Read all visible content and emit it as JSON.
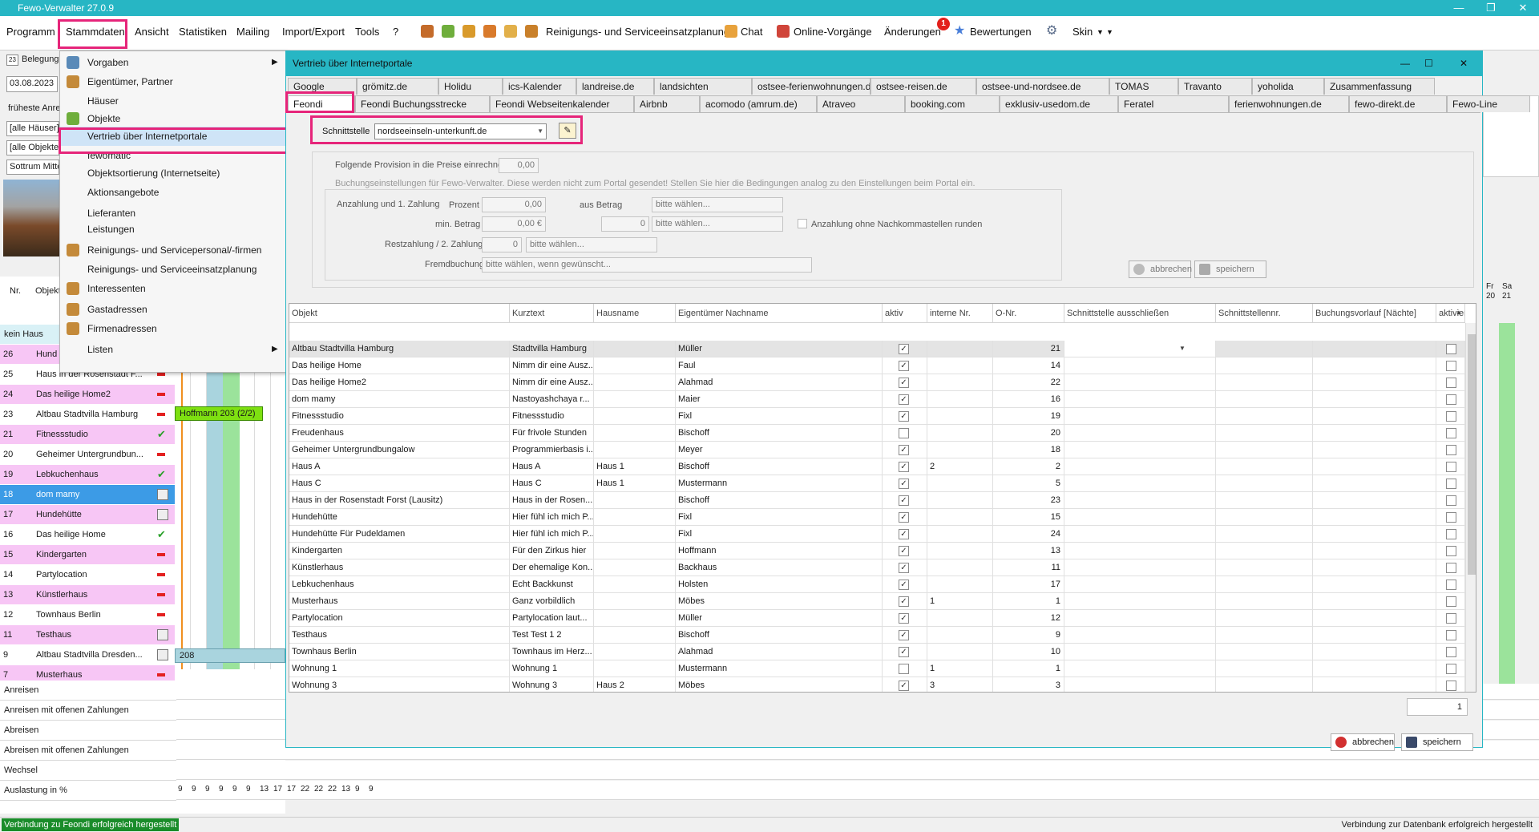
{
  "app": {
    "title": "Fewo-Verwalter 27.0.9"
  },
  "menu": {
    "items": [
      "Programm",
      "Stammdaten",
      "Ansicht",
      "Statistiken",
      "Mailing",
      "Import/Export",
      "Tools",
      "?"
    ],
    "tool_labels": [
      "Reinigungs- und Serviceeinsatzplanung",
      "Chat",
      "Online-Vorgänge",
      "Änderungen",
      "Bewertungen",
      "Skin"
    ],
    "badge": "1"
  },
  "dropdown": {
    "items": [
      {
        "label": "Vorgaben",
        "icon": "settings-icon",
        "submenu": true
      },
      {
        "label": "Eigentümer, Partner",
        "icon": "owner-icon"
      },
      {
        "label": "Häuser",
        "icon": ""
      },
      {
        "label": "Objekte",
        "icon": "house-icon"
      },
      {
        "label": "Vertrieb über Internetportale",
        "icon": "",
        "highlight": true
      },
      {
        "label": "fewomatic",
        "icon": ""
      },
      {
        "label": "Objektsortierung (Internetseite)",
        "icon": ""
      },
      {
        "label": "Aktionsangebote",
        "icon": ""
      },
      {
        "label": "Lieferanten",
        "icon": ""
      },
      {
        "label": "Leistungen",
        "icon": ""
      },
      {
        "label": "Reinigungs- und Servicepersonal/-firmen",
        "icon": "person-icon"
      },
      {
        "label": "Reinigungs- und Serviceeinsatzplanung",
        "icon": ""
      },
      {
        "label": "Interessenten",
        "icon": "person-icon"
      },
      {
        "label": "Gastadressen",
        "icon": "person-icon"
      },
      {
        "label": "Firmenadressen",
        "icon": "person-icon"
      },
      {
        "label": "Listen",
        "icon": "",
        "submenu": true
      }
    ]
  },
  "left": {
    "belegung": "Belegung",
    "date": "03.08.2023",
    "frueheste": "früheste Anre",
    "filter1": "[alle Häuser]",
    "filter2": "[alle Objekte",
    "filter3": "Sottrum Mitte",
    "col_nr": "Nr.",
    "col_obj": "Objekt",
    "kein_haus": "kein Haus",
    "rows": [
      {
        "nr": "26",
        "name": "Hund",
        "status": "red",
        "bg": "#f7c6f5"
      },
      {
        "nr": "25",
        "name": "Haus in der Rosenstadt F...",
        "status": "red",
        "bg": "#ffffff"
      },
      {
        "nr": "24",
        "name": "Das heilige Home2",
        "status": "red",
        "bg": "#f7c6f5"
      },
      {
        "nr": "23",
        "name": "Altbau Stadtvilla Hamburg",
        "status": "red",
        "bg": "#ffffff"
      },
      {
        "nr": "21",
        "name": "Fitnessstudio",
        "status": "green",
        "bg": "#f7c6f5"
      },
      {
        "nr": "20",
        "name": "Geheimer Untergrundbun...",
        "status": "red",
        "bg": "#ffffff"
      },
      {
        "nr": "19",
        "name": "Lebkuchenhaus",
        "status": "green",
        "bg": "#f7c6f5"
      },
      {
        "nr": "18",
        "name": "dom mamy",
        "status": "cal",
        "bg": "#3c9be6"
      },
      {
        "nr": "17",
        "name": "Hundehütte",
        "status": "cal",
        "bg": "#f7c6f5"
      },
      {
        "nr": "16",
        "name": "Das heilige Home",
        "status": "green",
        "bg": "#ffffff"
      },
      {
        "nr": "15",
        "name": "Kindergarten",
        "status": "red",
        "bg": "#f7c6f5"
      },
      {
        "nr": "14",
        "name": "Partylocation",
        "status": "red",
        "bg": "#ffffff"
      },
      {
        "nr": "13",
        "name": "Künstlerhaus",
        "status": "red",
        "bg": "#f7c6f5"
      },
      {
        "nr": "12",
        "name": "Townhaus Berlin",
        "status": "red",
        "bg": "#ffffff"
      },
      {
        "nr": "11",
        "name": "Testhaus",
        "status": "cal",
        "bg": "#f7c6f5"
      },
      {
        "nr": "9",
        "name": "Altbau Stadtvilla Dresden...",
        "status": "cal",
        "bg": "#ffffff"
      },
      {
        "nr": "7",
        "name": "Musterhaus",
        "status": "red",
        "bg": "#f7c6f5"
      }
    ],
    "booking1": "Hoffmann 203 (2/2)",
    "booking2": "208",
    "summary": [
      "Anreisen",
      "Anreisen mit offenen Zahlungen",
      "Abreisen",
      "Abreisen mit offenen Zahlungen",
      "Wechsel",
      "Auslastung in %"
    ],
    "auslastung": [
      "9",
      "9",
      "9",
      "9",
      "9",
      "9",
      "13",
      "17",
      "17",
      "22",
      "22",
      "22",
      "13",
      "9",
      "9"
    ],
    "cal_days": [
      "Fr",
      "Sa"
    ],
    "cal_nums": [
      "20",
      "21"
    ]
  },
  "dialog": {
    "title": "Vertrieb über Internetportale",
    "tabs_row1": [
      "Google",
      "grömitz.de",
      "Holidu",
      "ics-Kalender",
      "landreise.de",
      "landsichten",
      "ostsee-ferienwohnungen.de",
      "ostsee-reisen.de",
      "ostsee-und-nordsee.de",
      "TOMAS",
      "Travanto",
      "yoholida",
      "Zusammenfassung"
    ],
    "tabs_row2": [
      "Feondi",
      "Feondi Buchungsstrecke",
      "Feondi Webseitenkalender",
      "Airbnb",
      "acomodo (amrum.de)",
      "Atraveo",
      "booking.com",
      "exklusiv-usedom.de",
      "Feratel",
      "ferienwohnungen.de",
      "fewo-direkt.de",
      "Fewo-Line"
    ],
    "schnittstelle_label": "Schnittstelle",
    "schnittstelle_value": "nordseeinseln-unterkunft.de",
    "provision_label": "Folgende Provision in die Preise einrechnen",
    "provision_value": "0,00",
    "buchung_note": "Buchungseinstellungen für Fewo-Verwalter. Diese werden nicht zum Portal gesendet! Stellen Sie hier die Bedingungen analog zu den Einstellungen beim Portal ein.",
    "anzahlung_label": "Anzahlung und 1. Zahlung",
    "prozent_label": "Prozent",
    "prozent_value": "0,00",
    "aus_betrag_label": "aus Betrag",
    "bitte": "bitte wählen...",
    "min_betrag_label": "min. Betrag",
    "min_betrag_value": "0,00 €",
    "zero": "0",
    "runden_label": "Anzahlung ohne Nachkommastellen runden",
    "restzahlung_label": "Restzahlung / 2. Zahlung",
    "fremd_label": "Fremdbuchung",
    "fremd_value": "bitte wählen, wenn gewünscht...",
    "abbrechen": "abbrechen",
    "speichern": "speichern",
    "counter": "1"
  },
  "table": {
    "headers": [
      "Objekt",
      "Kurztext",
      "Hausname",
      "Eigentümer Nachname",
      "aktiv",
      "interne Nr.",
      "O-Nr.",
      "Schnittstelle ausschließen",
      "Schnittstellennr.",
      "Buchungsvorlauf [Nächte]",
      "aktivieren"
    ],
    "rows": [
      {
        "objekt": "Altbau Stadtvilla Hamburg",
        "kurz": "Stadtvilla Hamburg",
        "haus": "",
        "eig": "Müller",
        "aktiv": true,
        "intern": "",
        "onr": "21"
      },
      {
        "objekt": "Das heilige Home",
        "kurz": "Nimm dir eine Ausz...",
        "haus": "",
        "eig": "Faul",
        "aktiv": true,
        "intern": "",
        "onr": "14"
      },
      {
        "objekt": "Das heilige Home2",
        "kurz": "Nimm dir eine Ausz...",
        "haus": "",
        "eig": "Alahmad",
        "aktiv": true,
        "intern": "",
        "onr": "22"
      },
      {
        "objekt": "dom mamy",
        "kurz": "Nastoyashchaya r...",
        "haus": "",
        "eig": "Maier",
        "aktiv": true,
        "intern": "",
        "onr": "16"
      },
      {
        "objekt": "Fitnessstudio",
        "kurz": "Fitnessstudio",
        "haus": "",
        "eig": "Fixl",
        "aktiv": true,
        "intern": "",
        "onr": "19"
      },
      {
        "objekt": "Freudenhaus",
        "kurz": "Für frivole Stunden",
        "haus": "",
        "eig": "Bischoff",
        "aktiv": false,
        "intern": "",
        "onr": "20"
      },
      {
        "objekt": "Geheimer Untergrundbungalow",
        "kurz": "Programmierbasis i...",
        "haus": "",
        "eig": "Meyer",
        "aktiv": true,
        "intern": "",
        "onr": "18"
      },
      {
        "objekt": "Haus A",
        "kurz": "Haus A",
        "haus": "Haus 1",
        "eig": "Bischoff",
        "aktiv": true,
        "intern": "2",
        "onr": "2"
      },
      {
        "objekt": "Haus C",
        "kurz": "Haus C",
        "haus": "Haus 1",
        "eig": "Mustermann",
        "aktiv": true,
        "intern": "",
        "onr": "5"
      },
      {
        "objekt": "Haus in der Rosenstadt Forst (Lausitz)",
        "kurz": "Haus in der Rosen...",
        "haus": "",
        "eig": "Bischoff",
        "aktiv": true,
        "intern": "",
        "onr": "23"
      },
      {
        "objekt": "Hundehütte",
        "kurz": "Hier fühl ich mich P...",
        "haus": "",
        "eig": "Fixl",
        "aktiv": true,
        "intern": "",
        "onr": "15"
      },
      {
        "objekt": "Hundehütte Für Pudeldamen",
        "kurz": "Hier fühl ich mich P...",
        "haus": "",
        "eig": "Fixl",
        "aktiv": true,
        "intern": "",
        "onr": "24"
      },
      {
        "objekt": "Kindergarten",
        "kurz": "Für den Zirkus hier",
        "haus": "",
        "eig": "Hoffmann",
        "aktiv": true,
        "intern": "",
        "onr": "13"
      },
      {
        "objekt": "Künstlerhaus",
        "kurz": "Der ehemalige Kon...",
        "haus": "",
        "eig": "Backhaus",
        "aktiv": true,
        "intern": "",
        "onr": "11"
      },
      {
        "objekt": "Lebkuchenhaus",
        "kurz": "Echt Backkunst",
        "haus": "",
        "eig": "Holsten",
        "aktiv": true,
        "intern": "",
        "onr": "17"
      },
      {
        "objekt": "Musterhaus",
        "kurz": "Ganz vorbildlich",
        "haus": "",
        "eig": "Möbes",
        "aktiv": true,
        "intern": "1",
        "onr": "1"
      },
      {
        "objekt": "Partylocation",
        "kurz": "Partylocation laut...",
        "haus": "",
        "eig": "Müller",
        "aktiv": true,
        "intern": "",
        "onr": "12"
      },
      {
        "objekt": "Testhaus",
        "kurz": "Test Test 1 2",
        "haus": "",
        "eig": "Bischoff",
        "aktiv": true,
        "intern": "",
        "onr": "9"
      },
      {
        "objekt": "Townhaus Berlin",
        "kurz": "Townhaus im Herz...",
        "haus": "",
        "eig": "Alahmad",
        "aktiv": true,
        "intern": "",
        "onr": "10"
      },
      {
        "objekt": "Wohnung 1",
        "kurz": "Wohnung 1",
        "haus": "",
        "eig": "Mustermann",
        "aktiv": false,
        "intern": "1",
        "onr": "1"
      },
      {
        "objekt": "Wohnung 3",
        "kurz": "Wohnung 3",
        "haus": "Haus 2",
        "eig": "Möbes",
        "aktiv": true,
        "intern": "3",
        "onr": "3"
      }
    ]
  },
  "status": {
    "left": "Verbindung zu Feondi erfolgreich hergestellt",
    "right": "Verbindung zur Datenbank erfolgreich hergestellt"
  },
  "colors": {
    "accent": "#27b6c4",
    "highlight": "#e6257a",
    "pink_row": "#f7c6f5",
    "selected": "#3c9be6",
    "green": "#7ee011",
    "status_green": "#1a8c2a"
  }
}
